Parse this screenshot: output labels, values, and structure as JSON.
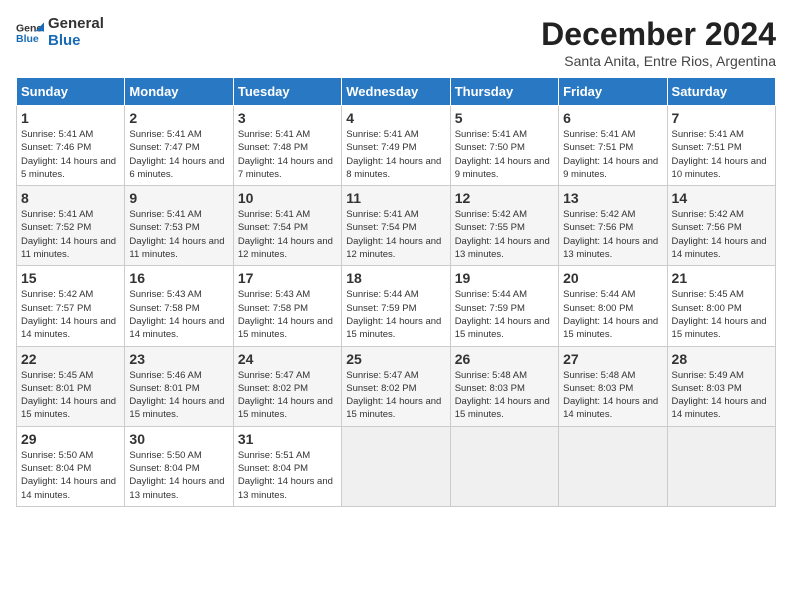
{
  "logo": {
    "line1": "General",
    "line2": "Blue"
  },
  "title": "December 2024",
  "subtitle": "Santa Anita, Entre Rios, Argentina",
  "days_of_week": [
    "Sunday",
    "Monday",
    "Tuesday",
    "Wednesday",
    "Thursday",
    "Friday",
    "Saturday"
  ],
  "weeks": [
    [
      {
        "day": "1",
        "sunrise": "5:41 AM",
        "sunset": "7:46 PM",
        "daylight": "14 hours and 5 minutes."
      },
      {
        "day": "2",
        "sunrise": "5:41 AM",
        "sunset": "7:47 PM",
        "daylight": "14 hours and 6 minutes."
      },
      {
        "day": "3",
        "sunrise": "5:41 AM",
        "sunset": "7:48 PM",
        "daylight": "14 hours and 7 minutes."
      },
      {
        "day": "4",
        "sunrise": "5:41 AM",
        "sunset": "7:49 PM",
        "daylight": "14 hours and 8 minutes."
      },
      {
        "day": "5",
        "sunrise": "5:41 AM",
        "sunset": "7:50 PM",
        "daylight": "14 hours and 9 minutes."
      },
      {
        "day": "6",
        "sunrise": "5:41 AM",
        "sunset": "7:51 PM",
        "daylight": "14 hours and 9 minutes."
      },
      {
        "day": "7",
        "sunrise": "5:41 AM",
        "sunset": "7:51 PM",
        "daylight": "14 hours and 10 minutes."
      }
    ],
    [
      {
        "day": "8",
        "sunrise": "5:41 AM",
        "sunset": "7:52 PM",
        "daylight": "14 hours and 11 minutes."
      },
      {
        "day": "9",
        "sunrise": "5:41 AM",
        "sunset": "7:53 PM",
        "daylight": "14 hours and 11 minutes."
      },
      {
        "day": "10",
        "sunrise": "5:41 AM",
        "sunset": "7:54 PM",
        "daylight": "14 hours and 12 minutes."
      },
      {
        "day": "11",
        "sunrise": "5:41 AM",
        "sunset": "7:54 PM",
        "daylight": "14 hours and 12 minutes."
      },
      {
        "day": "12",
        "sunrise": "5:42 AM",
        "sunset": "7:55 PM",
        "daylight": "14 hours and 13 minutes."
      },
      {
        "day": "13",
        "sunrise": "5:42 AM",
        "sunset": "7:56 PM",
        "daylight": "14 hours and 13 minutes."
      },
      {
        "day": "14",
        "sunrise": "5:42 AM",
        "sunset": "7:56 PM",
        "daylight": "14 hours and 14 minutes."
      }
    ],
    [
      {
        "day": "15",
        "sunrise": "5:42 AM",
        "sunset": "7:57 PM",
        "daylight": "14 hours and 14 minutes."
      },
      {
        "day": "16",
        "sunrise": "5:43 AM",
        "sunset": "7:58 PM",
        "daylight": "14 hours and 14 minutes."
      },
      {
        "day": "17",
        "sunrise": "5:43 AM",
        "sunset": "7:58 PM",
        "daylight": "14 hours and 15 minutes."
      },
      {
        "day": "18",
        "sunrise": "5:44 AM",
        "sunset": "7:59 PM",
        "daylight": "14 hours and 15 minutes."
      },
      {
        "day": "19",
        "sunrise": "5:44 AM",
        "sunset": "7:59 PM",
        "daylight": "14 hours and 15 minutes."
      },
      {
        "day": "20",
        "sunrise": "5:44 AM",
        "sunset": "8:00 PM",
        "daylight": "14 hours and 15 minutes."
      },
      {
        "day": "21",
        "sunrise": "5:45 AM",
        "sunset": "8:00 PM",
        "daylight": "14 hours and 15 minutes."
      }
    ],
    [
      {
        "day": "22",
        "sunrise": "5:45 AM",
        "sunset": "8:01 PM",
        "daylight": "14 hours and 15 minutes."
      },
      {
        "day": "23",
        "sunrise": "5:46 AM",
        "sunset": "8:01 PM",
        "daylight": "14 hours and 15 minutes."
      },
      {
        "day": "24",
        "sunrise": "5:47 AM",
        "sunset": "8:02 PM",
        "daylight": "14 hours and 15 minutes."
      },
      {
        "day": "25",
        "sunrise": "5:47 AM",
        "sunset": "8:02 PM",
        "daylight": "14 hours and 15 minutes."
      },
      {
        "day": "26",
        "sunrise": "5:48 AM",
        "sunset": "8:03 PM",
        "daylight": "14 hours and 15 minutes."
      },
      {
        "day": "27",
        "sunrise": "5:48 AM",
        "sunset": "8:03 PM",
        "daylight": "14 hours and 14 minutes."
      },
      {
        "day": "28",
        "sunrise": "5:49 AM",
        "sunset": "8:03 PM",
        "daylight": "14 hours and 14 minutes."
      }
    ],
    [
      {
        "day": "29",
        "sunrise": "5:50 AM",
        "sunset": "8:04 PM",
        "daylight": "14 hours and 14 minutes."
      },
      {
        "day": "30",
        "sunrise": "5:50 AM",
        "sunset": "8:04 PM",
        "daylight": "14 hours and 13 minutes."
      },
      {
        "day": "31",
        "sunrise": "5:51 AM",
        "sunset": "8:04 PM",
        "daylight": "14 hours and 13 minutes."
      },
      null,
      null,
      null,
      null
    ]
  ],
  "labels": {
    "sunrise": "Sunrise:",
    "sunset": "Sunset:",
    "daylight": "Daylight:"
  }
}
